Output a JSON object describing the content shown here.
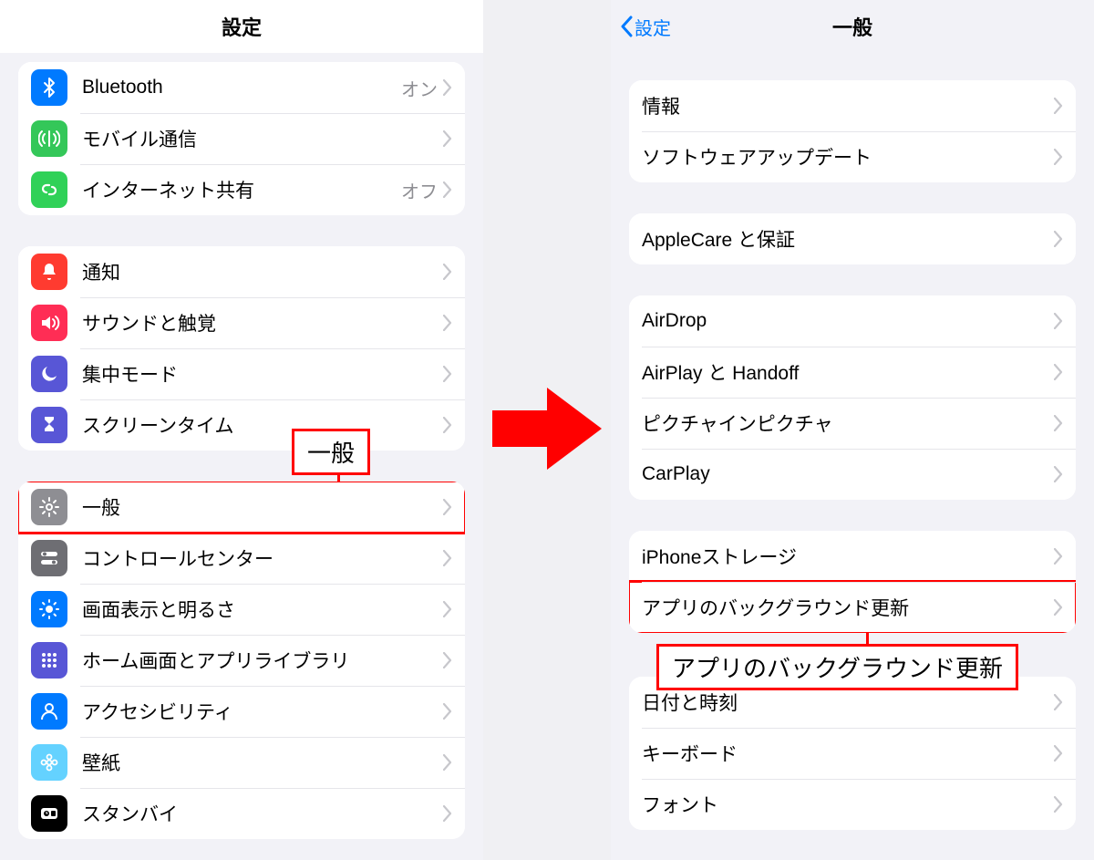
{
  "left": {
    "title": "設定",
    "groups": [
      [
        {
          "icon": "bluetooth",
          "bg": "bg-blue",
          "label": "Bluetooth",
          "value": "オン"
        },
        {
          "icon": "antenna",
          "bg": "bg-green",
          "label": "モバイル通信",
          "value": ""
        },
        {
          "icon": "link",
          "bg": "bg-green2",
          "label": "インターネット共有",
          "value": "オフ"
        }
      ],
      [
        {
          "icon": "bell",
          "bg": "bg-red",
          "label": "通知",
          "value": ""
        },
        {
          "icon": "speaker",
          "bg": "bg-pink",
          "label": "サウンドと触覚",
          "value": ""
        },
        {
          "icon": "moon",
          "bg": "bg-indigo",
          "label": "集中モード",
          "value": ""
        },
        {
          "icon": "hourglass",
          "bg": "bg-indigo",
          "label": "スクリーンタイム",
          "value": ""
        }
      ],
      [
        {
          "icon": "gear",
          "bg": "bg-gray",
          "label": "一般",
          "value": "",
          "highlight": true
        },
        {
          "icon": "toggles",
          "bg": "bg-darkgray",
          "label": "コントロールセンター",
          "value": ""
        },
        {
          "icon": "sun",
          "bg": "bg-blue",
          "label": "画面表示と明るさ",
          "value": ""
        },
        {
          "icon": "grid",
          "bg": "bg-indigo",
          "label": "ホーム画面とアプリライブラリ",
          "value": ""
        },
        {
          "icon": "person",
          "bg": "bg-blue",
          "label": "アクセシビリティ",
          "value": ""
        },
        {
          "icon": "flower",
          "bg": "bg-teal",
          "label": "壁紙",
          "value": ""
        },
        {
          "icon": "clock",
          "bg": "bg-black",
          "label": "スタンバイ",
          "value": ""
        }
      ]
    ],
    "callout": "一般"
  },
  "right": {
    "back": "設定",
    "title": "一般",
    "groups": [
      [
        {
          "label": "情報"
        },
        {
          "label": "ソフトウェアアップデート"
        }
      ],
      [
        {
          "label": "AppleCare と保証"
        }
      ],
      [
        {
          "label": "AirDrop"
        },
        {
          "label": "AirPlay と Handoff"
        },
        {
          "label": "ピクチャインピクチャ"
        },
        {
          "label": "CarPlay"
        }
      ],
      [
        {
          "label": "iPhoneストレージ"
        },
        {
          "label": "アプリのバックグラウンド更新",
          "highlight": true
        }
      ],
      [
        {
          "label": "日付と時刻"
        },
        {
          "label": "キーボード"
        },
        {
          "label": "フォント"
        }
      ]
    ],
    "callout": "アプリのバックグラウンド更新"
  }
}
